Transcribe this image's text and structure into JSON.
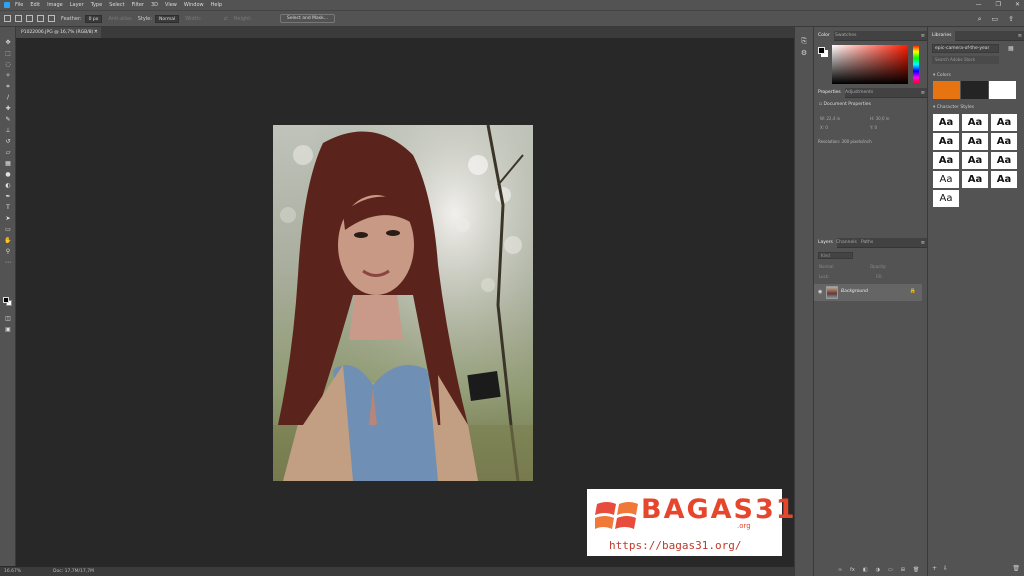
{
  "menubar": {
    "items": [
      "File",
      "Edit",
      "Image",
      "Layer",
      "Type",
      "Select",
      "Filter",
      "3D",
      "View",
      "Window",
      "Help"
    ],
    "window_controls": [
      "—",
      "❐",
      "✕"
    ]
  },
  "options_bar": {
    "feather_label": "Feather:",
    "feather_value": "0 px",
    "antialias_label": "Anti-alias",
    "style_label": "Style:",
    "style_value": "Normal",
    "width_label": "Width:",
    "height_label": "Height:",
    "select_mask_label": "Select and Mask..."
  },
  "document": {
    "tab_label": "P1022006.JPG @ 16,7% (RGB/8) *",
    "tab_close": "×"
  },
  "status": {
    "zoom": "16.67%",
    "doc_info": "Doc: 17,7M/17,7M"
  },
  "watermark": {
    "name": "BAGAS",
    "number": "31",
    "org": ".org",
    "url": "https://bagas31.org/"
  },
  "color_panel": {
    "tabs": [
      "Color",
      "Swatches"
    ],
    "foreground": "#000000",
    "background": "#ffffff"
  },
  "properties_panel": {
    "tabs": [
      "Properties",
      "Adjustments"
    ],
    "heading": "Document Properties",
    "w_label": "W:",
    "w_value": "22,4 in",
    "h_label": "H:",
    "h_value": "30,0 in",
    "x_label": "X:",
    "x_value": "0",
    "y_label": "Y:",
    "y_value": "0",
    "resolution": "Resolution: 300 pixels/inch"
  },
  "layers_panel": {
    "tabs": [
      "Layers",
      "Channels",
      "Paths"
    ],
    "filter_placeholder": "Kind",
    "blend_mode": "Normal",
    "opacity_label": "Opacity:",
    "lock_label": "Lock:",
    "fill_label": "Fill:",
    "layer_name": "Background"
  },
  "libraries_panel": {
    "tab": "Libraries",
    "library_name": "epic-camera-of-the-year",
    "search_placeholder": "Search Adobe Stock",
    "colors_heading": "Colors",
    "colors": [
      "#e87411",
      "#242424",
      "#ffffff"
    ],
    "char_styles_heading": "Character Styles",
    "char_styles": [
      "Aa",
      "Aa",
      "Aa",
      "Aa",
      "Aa",
      "Aa",
      "Aa",
      "Aa",
      "Aa",
      "Aa",
      "Aa",
      "Aa",
      "Aa"
    ]
  }
}
